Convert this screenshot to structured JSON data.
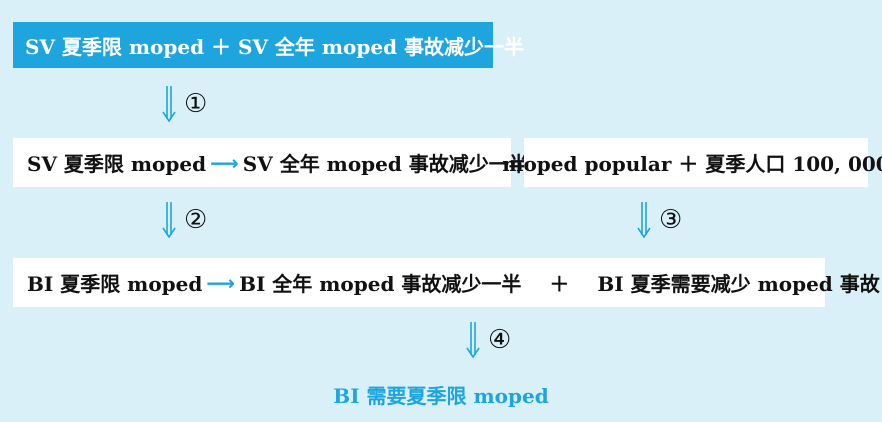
{
  "colors": {
    "background": "#d9f0f8",
    "accent": "#1ea5de",
    "box": "#ffffff",
    "text": "#111111"
  },
  "premise_top": "SV 夏季限 moped ＋ SV 全年 moped 事故减少一半",
  "row2": {
    "left": {
      "antecedent": "SV 夏季限 moped",
      "arrow": "⟶",
      "consequent": "SV 全年 moped 事故减少一半"
    },
    "right": "moped popular ＋ 夏季人口 100, 000"
  },
  "row3": {
    "antecedent": "BI 夏季限 moped",
    "arrow": "⟶",
    "consequent": "BI 全年 moped 事故减少一半",
    "plus": "＋",
    "addition": "BI 夏季需要减少 moped 事故"
  },
  "steps": [
    "①",
    "②",
    "③",
    "④"
  ],
  "conclusion": "BI 需要夏季限 moped"
}
